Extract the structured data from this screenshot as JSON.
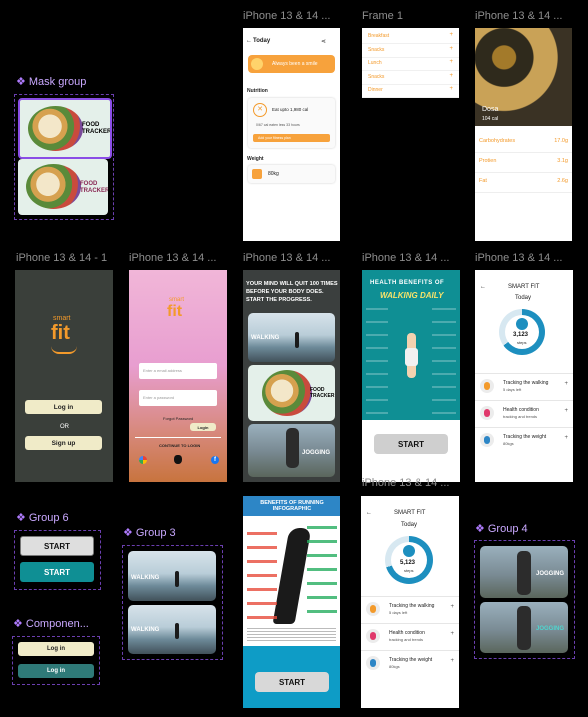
{
  "labels": {
    "frame_top_1": "iPhone 13 & 14 ...",
    "frame_top_2": "Frame 1",
    "frame_top_3": "iPhone 13 & 14 ...",
    "mask_group": "Mask group",
    "frame_mid_1": "iPhone 13 & 14 - 1",
    "frame_mid_2": "iPhone 13 & 14 ...",
    "frame_mid_3": "iPhone 13 & 14 ...",
    "frame_mid_4": "iPhone 13 & 14 ...",
    "frame_mid_5": "iPhone 13 & 14 ...",
    "group6": "Group 6",
    "group3": "Group 3",
    "group4": "Group 4",
    "component": "Componen...",
    "frame_bot_2": "iPhone 13 & 14 ..."
  },
  "today_screen": {
    "title": "Today",
    "mood_text": "Always been a smile",
    "nutrition_heading": "Nutrition",
    "nutrition_item": "Eat upto 1,980 cal",
    "nutrition_sub": "0/67 cal eaten less 33 hours",
    "nutrition_button": "Add your fitness plan",
    "weight_heading": "Weight",
    "weight_value": "80kg"
  },
  "meals": [
    "Breakfast",
    "Snacks",
    "Lunch",
    "Snacks",
    "Dinner"
  ],
  "dosa": {
    "name": "Dosa",
    "kcal": "104 cal",
    "rows": [
      {
        "label": "Carbohydrates",
        "value": "17.0g"
      },
      {
        "label": "Protien",
        "value": "3.1g"
      },
      {
        "label": "Fat",
        "value": "2.6g"
      }
    ]
  },
  "mask_group": {
    "card1_text": "FOOD\nTRACKER",
    "card2_text": "FOOD\nTRACKER"
  },
  "splash": {
    "logo_small": "smart",
    "logo_big": "fit",
    "login": "Log in",
    "or": "OR",
    "signup": "Sign up"
  },
  "login_screen": {
    "logo_small": "smart",
    "logo_big": "fit",
    "email_placeholder": "Enter a email address",
    "password_placeholder": "Enter a password",
    "forgot": "Forgot Password",
    "login_btn": "Login",
    "continue": "CONTINUE TO LOGIN"
  },
  "motivation": {
    "headline": "YOUR MIND WILL QUIT 100 TIMES BEFORE YOUR BODY DOES. START THE PROGRESS.",
    "walking": "WALKING",
    "food": "FOOD TRACKER",
    "jogging": "JOGGING"
  },
  "walking_info": {
    "title_top": "HEALTH BENEFITS OF",
    "title_main": "WALKING DAILY",
    "start": "START"
  },
  "smartfit_1": {
    "title": "SMART FIT",
    "today": "Today",
    "steps": "3,123",
    "steps_unit": "steps",
    "items": [
      {
        "title": "Tracking the walking",
        "sub": "5 days left"
      },
      {
        "title": "Health condition",
        "sub": "tracking and trends"
      },
      {
        "title": "Tracking the weight",
        "sub": "80kgs"
      }
    ]
  },
  "group6": {
    "start1": "START",
    "start2": "START"
  },
  "group3": {
    "walking1": "WALKING",
    "walking2": "WALKING"
  },
  "component": {
    "login1": "Log in",
    "login2": "Log in"
  },
  "running": {
    "title": "BENEFITS OF RUNNING INFOGRAPHIC",
    "start": "START"
  },
  "smartfit_2": {
    "title": "SMART FIT",
    "today": "Today",
    "steps": "5,123",
    "steps_unit": "steps",
    "items": [
      {
        "title": "Tracking the walking",
        "sub": "5 days left"
      },
      {
        "title": "Health condition",
        "sub": "tracking and trends"
      },
      {
        "title": "Tracking the weight",
        "sub": "80kgs"
      }
    ]
  },
  "group4": {
    "jogging1": "JOGGING",
    "jogging2": "JOGGING"
  },
  "colors": {
    "orange": "#f39a2b",
    "teal": "#0f8f94",
    "dark_green": "#333a35",
    "cream": "#f0ebc8",
    "pink": "#e8a7c9",
    "ring_blue": "#1d8fbf",
    "purple_label": "#c9a8ff"
  }
}
